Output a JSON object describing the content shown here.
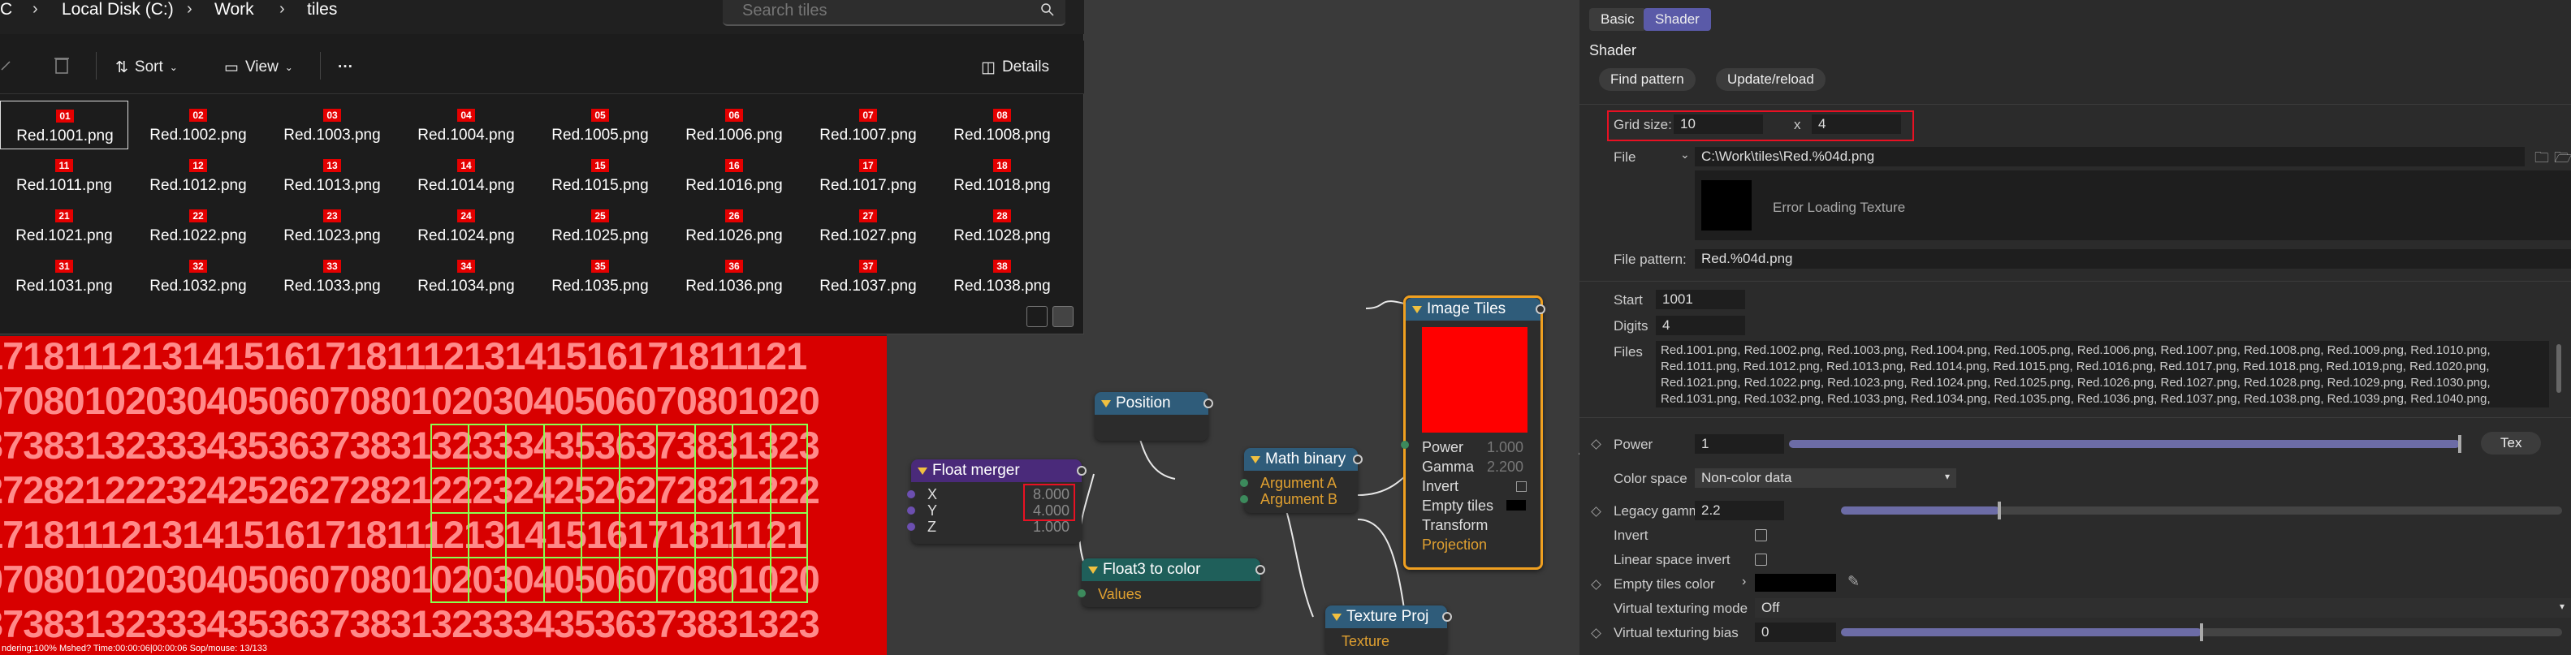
{
  "explorer": {
    "breadcrumb": [
      "C",
      "Local Disk (C:)",
      "Work",
      "tiles"
    ],
    "search_placeholder": "Search tiles",
    "toolbar": {
      "sort": "Sort",
      "view": "View",
      "more": "···",
      "details": "Details"
    },
    "files": [
      {
        "thumb": "01",
        "name": "Red.1001.png"
      },
      {
        "thumb": "02",
        "name": "Red.1002.png"
      },
      {
        "thumb": "03",
        "name": "Red.1003.png"
      },
      {
        "thumb": "04",
        "name": "Red.1004.png"
      },
      {
        "thumb": "05",
        "name": "Red.1005.png"
      },
      {
        "thumb": "06",
        "name": "Red.1006.png"
      },
      {
        "thumb": "07",
        "name": "Red.1007.png"
      },
      {
        "thumb": "08",
        "name": "Red.1008.png"
      },
      {
        "thumb": "11",
        "name": "Red.1011.png"
      },
      {
        "thumb": "12",
        "name": "Red.1012.png"
      },
      {
        "thumb": "13",
        "name": "Red.1013.png"
      },
      {
        "thumb": "14",
        "name": "Red.1014.png"
      },
      {
        "thumb": "15",
        "name": "Red.1015.png"
      },
      {
        "thumb": "16",
        "name": "Red.1016.png"
      },
      {
        "thumb": "17",
        "name": "Red.1017.png"
      },
      {
        "thumb": "18",
        "name": "Red.1018.png"
      },
      {
        "thumb": "21",
        "name": "Red.1021.png"
      },
      {
        "thumb": "22",
        "name": "Red.1022.png"
      },
      {
        "thumb": "23",
        "name": "Red.1023.png"
      },
      {
        "thumb": "24",
        "name": "Red.1024.png"
      },
      {
        "thumb": "25",
        "name": "Red.1025.png"
      },
      {
        "thumb": "26",
        "name": "Red.1026.png"
      },
      {
        "thumb": "27",
        "name": "Red.1027.png"
      },
      {
        "thumb": "28",
        "name": "Red.1028.png"
      },
      {
        "thumb": "31",
        "name": "Red.1031.png"
      },
      {
        "thumb": "32",
        "name": "Red.1032.png"
      },
      {
        "thumb": "33",
        "name": "Red.1033.png"
      },
      {
        "thumb": "34",
        "name": "Red.1034.png"
      },
      {
        "thumb": "35",
        "name": "Red.1035.png"
      },
      {
        "thumb": "36",
        "name": "Red.1036.png"
      },
      {
        "thumb": "37",
        "name": "Red.1037.png"
      },
      {
        "thumb": "38",
        "name": "Red.1038.png"
      }
    ]
  },
  "viewport": {
    "rows": [
      "17181112131415161718111213141516171811121",
      "07080102030405060708010203040506070801020",
      "37383132333435363738313233343536373831323",
      "27282122232425262728212223242526272821222",
      "17181112131415161718111213141516171811121",
      "07080102030405060708010203040506070801020",
      "37383132333435363738313233343536373831323"
    ],
    "status": "ndering:100% Mshed? Time:00:00:06|00:00:06 Sop/mouse: 13/133"
  },
  "nodes": {
    "position": {
      "title": "Position"
    },
    "float_merger": {
      "title": "Float merger",
      "x_label": "X",
      "x_value": "8.000",
      "y_label": "Y",
      "y_value": "4.000",
      "z_label": "Z",
      "z_value": "1.000"
    },
    "math_binary": {
      "title": "Math binary",
      "arg_a": "Argument A",
      "arg_b": "Argument B"
    },
    "float3_to_color": {
      "title": "Float3 to color",
      "values": "Values"
    },
    "texture_proj": {
      "title": "Texture Proj",
      "texture": "Texture"
    },
    "image_tiles": {
      "title": "Image Tiles",
      "power": "Power",
      "power_value": "1.000",
      "gamma": "Gamma",
      "gamma_value": "2.200",
      "invert": "Invert",
      "empty_tiles": "Empty tiles",
      "transform": "Transform",
      "projection": "Projection"
    }
  },
  "props": {
    "tabs": {
      "basic": "Basic",
      "shader": "Shader"
    },
    "section": "Shader",
    "find_pattern": "Find pattern",
    "update_reload": "Update/reload",
    "grid_size_label": "Grid size:",
    "grid_x": "10",
    "grid_x_sep": "x",
    "grid_y": "4",
    "file_label": "File",
    "file_path": "C:\\Work\\tiles\\Red.%04d.png",
    "error_text": "Error Loading Texture",
    "file_pattern_label": "File pattern:",
    "file_pattern_value": "Red.%04d.png",
    "start_label": "Start",
    "start_value": "1001",
    "digits_label": "Digits",
    "digits_value": "4",
    "files_label": "Files",
    "files_lines": [
      "Red.1001.png, Red.1002.png, Red.1003.png, Red.1004.png, Red.1005.png, Red.1006.png, Red.1007.png, Red.1008.png, Red.1009.png, Red.1010.png,",
      "Red.1011.png, Red.1012.png, Red.1013.png, Red.1014.png, Red.1015.png, Red.1016.png, Red.1017.png, Red.1018.png, Red.1019.png, Red.1020.png,",
      "Red.1021.png, Red.1022.png, Red.1023.png, Red.1024.png, Red.1025.png, Red.1026.png, Red.1027.png, Red.1028.png, Red.1029.png, Red.1030.png,",
      "Red.1031.png, Red.1032.png, Red.1033.png, Red.1034.png, Red.1035.png, Red.1036.png, Red.1037.png, Red.1038.png, Red.1039.png, Red.1040.png,"
    ],
    "power_label": "Power",
    "power_value": "1",
    "power_level": 1.0,
    "tex_button": "Tex",
    "color_space_label": "Color space",
    "color_space_value": "Non-color data",
    "legacy_gamma_label": "Legacy gamma",
    "legacy_gamma_value": "2.2",
    "legacy_gamma_level": 0.22,
    "invert_label": "Invert",
    "linear_label": "Linear space invert",
    "empty_tiles_label": "Empty tiles color",
    "vt_mode_label": "Virtual texturing mode",
    "vt_mode_value": "Off",
    "vt_bias_label": "Virtual texturing bias",
    "vt_bias_value": "0",
    "vt_bias_level": 0.5
  },
  "colors": {
    "accent": "#5a5aa8",
    "highlight_red": "#e81123",
    "node_orange": "#f0a020",
    "tile_red": "#d80000"
  }
}
